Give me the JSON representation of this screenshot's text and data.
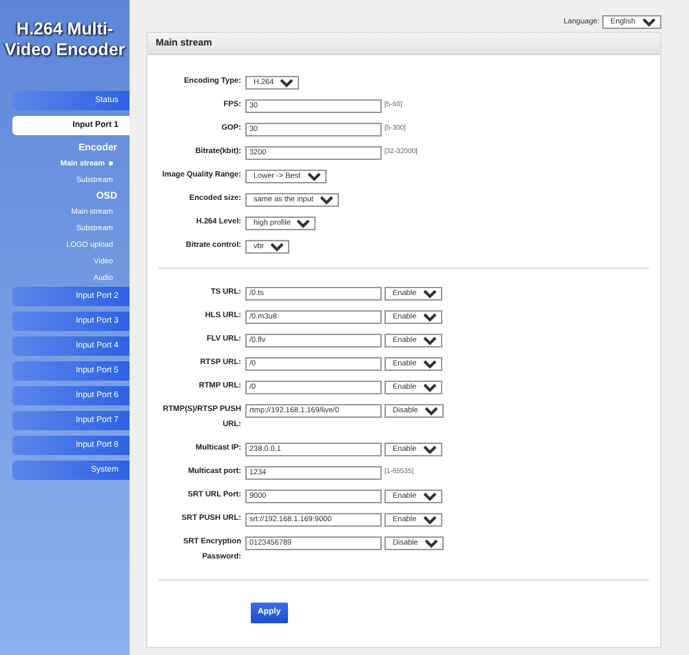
{
  "sidebar": {
    "title": "H.264 Multi-Video Encoder",
    "items": [
      {
        "label": "Status",
        "kind": "port",
        "selected": false
      },
      {
        "label": "Input Port 1",
        "kind": "port",
        "selected": true
      },
      {
        "label": "Encoder",
        "kind": "group",
        "selected": false
      },
      {
        "label": "Main stream",
        "kind": "sub",
        "selected": true
      },
      {
        "label": "Substream",
        "kind": "sub",
        "selected": false
      },
      {
        "label": "OSD",
        "kind": "group",
        "selected": false
      },
      {
        "label": "Main stream",
        "kind": "sub",
        "selected": false
      },
      {
        "label": "Substream",
        "kind": "sub",
        "selected": false
      },
      {
        "label": "LOGO upload",
        "kind": "sub",
        "selected": false
      },
      {
        "label": "Video",
        "kind": "sub",
        "selected": false
      },
      {
        "label": "Audio",
        "kind": "sub",
        "selected": false
      },
      {
        "label": "Input Port 2",
        "kind": "port",
        "selected": false
      },
      {
        "label": "Input Port 3",
        "kind": "port",
        "selected": false
      },
      {
        "label": "Input Port 4",
        "kind": "port",
        "selected": false
      },
      {
        "label": "Input Port 5",
        "kind": "port",
        "selected": false
      },
      {
        "label": "Input Port 6",
        "kind": "port",
        "selected": false
      },
      {
        "label": "Input Port 7",
        "kind": "port",
        "selected": false
      },
      {
        "label": "Input Port 8",
        "kind": "port",
        "selected": false
      },
      {
        "label": "System",
        "kind": "port",
        "selected": false
      }
    ]
  },
  "language": {
    "label": "Language:",
    "value": "English"
  },
  "panel": {
    "title": "Main stream",
    "sections": [
      [
        {
          "kind": "select",
          "label": "Encoding Type:",
          "option": "H.264"
        },
        {
          "kind": "input",
          "label": "FPS:",
          "value": "30",
          "range": "[5-60]"
        },
        {
          "kind": "input",
          "label": "GOP:",
          "value": "30",
          "range": "[5-300]"
        },
        {
          "kind": "input",
          "label": "Bitrate(kbit):",
          "value": "3200",
          "range": "[32-32000]"
        },
        {
          "kind": "select",
          "label": "Image Quality Range:",
          "option": "Lower -> Best"
        },
        {
          "kind": "select",
          "label": "Encoded size:",
          "option": "same as the input"
        },
        {
          "kind": "select",
          "label": "H.264 Level:",
          "option": "high profile"
        },
        {
          "kind": "select",
          "label": "Bitrate control:",
          "option": "vbr"
        }
      ],
      [
        {
          "kind": "input_select",
          "label": "TS URL:",
          "value": "/0.ts",
          "option": "Enable"
        },
        {
          "kind": "input_select",
          "label": "HLS URL:",
          "value": "/0.m3u8",
          "option": "Enable"
        },
        {
          "kind": "input_select",
          "label": "FLV URL:",
          "value": "/0.flv",
          "option": "Enable"
        },
        {
          "kind": "input_select",
          "label": "RTSP URL:",
          "value": "/0",
          "option": "Enable"
        },
        {
          "kind": "input_select",
          "label": "RTMP URL:",
          "value": "/0",
          "option": "Enable"
        },
        {
          "kind": "input_select",
          "label": "RTMP(S)/RTSP PUSH URL:",
          "value": "rtmp://192.168.1.169/live/0",
          "option": "Disable"
        },
        {
          "kind": "input_select",
          "label": "Multicast IP:",
          "value": "238.0.0.1",
          "option": "Enable"
        },
        {
          "kind": "input",
          "label": "Multicast port:",
          "value": "1234",
          "range": "[1-65535]"
        },
        {
          "kind": "input_select",
          "label": "SRT URL Port:",
          "value": "9000",
          "option": "Enable"
        },
        {
          "kind": "input_select",
          "label": "SRT PUSH URL:",
          "value": "srt://192.168.1.169:9000",
          "option": "Enable"
        },
        {
          "kind": "input_select",
          "label": "SRT Encryption Password:",
          "value": "0123456789",
          "option": "Disable"
        }
      ]
    ],
    "apply": "Apply"
  }
}
